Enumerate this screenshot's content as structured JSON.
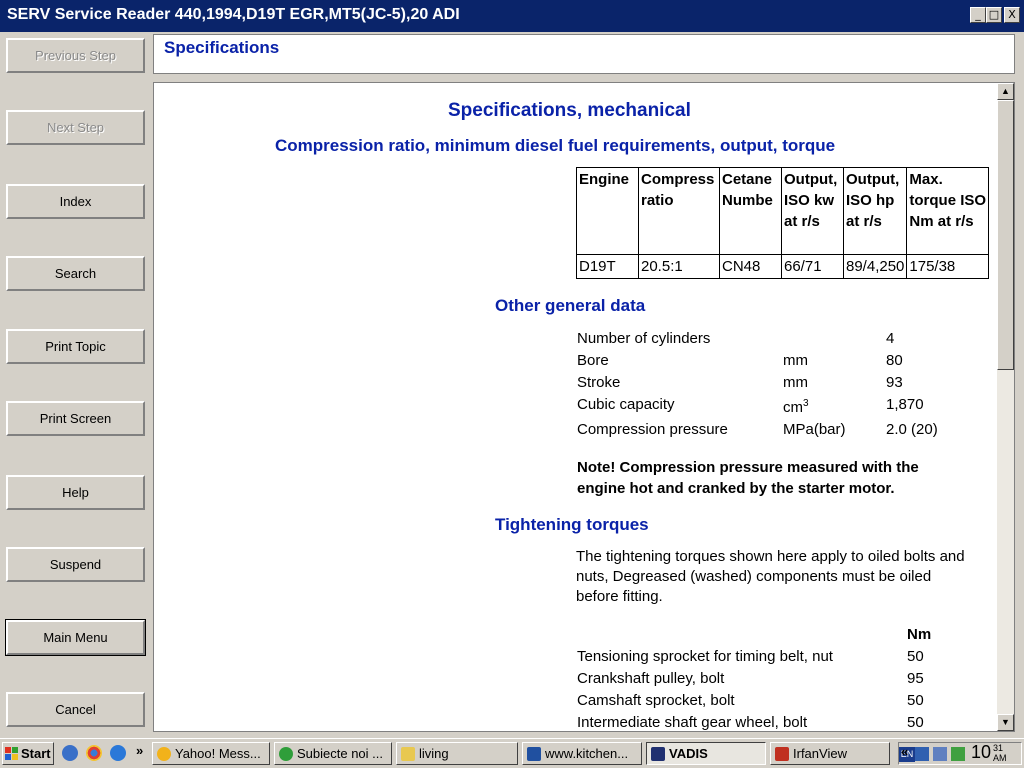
{
  "window": {
    "title": "SERV Service Reader 440,1994,D19T EGR,MT5(JC-5),20 ADI",
    "minimize": "_",
    "maximize": "□",
    "close": "X"
  },
  "sidebar": {
    "previous_step": "Previous Step",
    "next_step": "Next Step",
    "index": "Index",
    "search": "Search",
    "print_topic": "Print Topic",
    "print_screen": "Print Screen",
    "help": "Help",
    "suspend": "Suspend",
    "main_menu": "Main Menu",
    "cancel": "Cancel"
  },
  "header": {
    "title": "Specifications"
  },
  "content": {
    "heading": "Specifications, mechanical",
    "subheading": "Compression ratio, minimum diesel fuel requirements, output, torque",
    "table": {
      "headers": [
        "Engine",
        "Compress ratio",
        "Cetane Numbe",
        "Output, ISO kw at r/s",
        "Output, ISO hp at r/s",
        "Max. torque ISO Nm at r/s"
      ],
      "row": [
        "D19T",
        "20.5:1",
        "CN48",
        "66/71",
        "89/4,250",
        "175/38"
      ]
    },
    "general": {
      "heading": "Other general data",
      "rows": [
        {
          "label": "Number of cylinders",
          "unit": "",
          "unit_sup": "",
          "value": "4"
        },
        {
          "label": "Bore",
          "unit": "mm",
          "unit_sup": "",
          "value": "80"
        },
        {
          "label": "Stroke",
          "unit": "mm",
          "unit_sup": "",
          "value": "93"
        },
        {
          "label": "Cubic capacity",
          "unit": "cm",
          "unit_sup": "3",
          "value": "1,870"
        },
        {
          "label": "Compression pressure",
          "unit": "MPa(bar)",
          "unit_sup": "",
          "value": "2.0 (20)"
        }
      ],
      "note_line1": "Note! Compression pressure measured with the",
      "note_line2": "engine hot and cranked by the starter motor."
    },
    "torques": {
      "heading": "Tightening torques",
      "intro_line1": "The tightening torques shown here apply to oiled bolts and",
      "intro_line2": "nuts, Degreased (washed) components must be oiled",
      "intro_line3": "before fitting.",
      "unit_header": "Nm",
      "rows": [
        {
          "label": "Tensioning sprocket for timing belt, nut",
          "value": "50"
        },
        {
          "label": "Crankshaft pulley, bolt",
          "value": "95"
        },
        {
          "label": "Camshaft sprocket, bolt",
          "value": "50"
        },
        {
          "label": "Intermediate shaft gear wheel, bolt",
          "value": "50"
        }
      ]
    }
  },
  "taskbar": {
    "start": "Start",
    "chevron": "»",
    "tasks": [
      {
        "label": "Yahoo! Mess...",
        "icon": "yahoo-messenger-icon",
        "color": "#f2b21a"
      },
      {
        "label": "Subiecte noi ...",
        "icon": "chrome-icon",
        "color": "#2f9e3a"
      },
      {
        "label": "living",
        "icon": "folder-icon",
        "color": "#e8c850"
      },
      {
        "label": "www.kitchen...",
        "icon": "kd-icon",
        "color": "#2050a0"
      },
      {
        "label": "VADIS",
        "icon": "vadis-icon",
        "color": "#203070"
      },
      {
        "label": "IrfanView",
        "icon": "irfanview-icon",
        "color": "#c03020"
      }
    ],
    "tray": {
      "lang": "EN",
      "chevron": "«",
      "clock_hour": "10",
      "clock_min": "31",
      "clock_ampm": "AM"
    }
  }
}
